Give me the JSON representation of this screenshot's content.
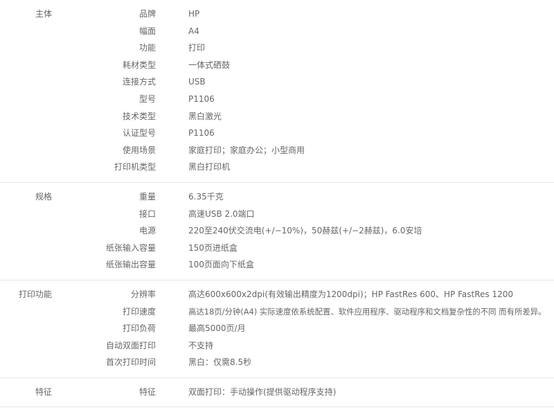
{
  "groups": [
    {
      "title": "主体",
      "rows": [
        {
          "label": "品牌",
          "value": "HP"
        },
        {
          "label": "幅面",
          "value": "A4"
        },
        {
          "label": "功能",
          "value": "打印"
        },
        {
          "label": "耗材类型",
          "value": "一体式硒鼓"
        },
        {
          "label": "连接方式",
          "value": "USB"
        },
        {
          "label": "型号",
          "value": "P1106"
        },
        {
          "label": "技术类型",
          "value": "黑白激光"
        },
        {
          "label": "认证型号",
          "value": "P1106"
        },
        {
          "label": "使用场景",
          "value": "家庭打印；家庭办公；小型商用"
        },
        {
          "label": "打印机类型",
          "value": "黑白打印机"
        }
      ]
    },
    {
      "title": "规格",
      "rows": [
        {
          "label": "重量",
          "value": "6.35千克"
        },
        {
          "label": "接口",
          "value": "高速USB 2.0端口"
        },
        {
          "label": "电源",
          "value": "220至240伏交流电(+/−10%)，50赫兹(+/−2赫兹)，6.0安培"
        },
        {
          "label": "纸张输入容量",
          "value": "150页进纸盒"
        },
        {
          "label": "纸张输出容量",
          "value": "100页面向下纸盒"
        }
      ]
    },
    {
      "title": "打印功能",
      "rows": [
        {
          "label": "分辨率",
          "value": "高达600x600x2dpi(有效输出精度为1200dpi)；HP FastRes 600、HP FastRes 1200"
        },
        {
          "label": "打印速度",
          "value": "高达18页/分钟(A4) 实际速度依系统配置、软件应用程序、驱动程序和文档复杂性的不同 而有所差异。"
        },
        {
          "label": "打印负荷",
          "value": "最高5000页/月"
        },
        {
          "label": "自动双面打印",
          "value": "不支持"
        },
        {
          "label": "首次打印时间",
          "value": "黑白：仅需8.5秒"
        }
      ]
    },
    {
      "title": "特征",
      "rows": [
        {
          "label": "特征",
          "value": "双面打印：手动操作(提供驱动程序支持)"
        }
      ]
    }
  ]
}
